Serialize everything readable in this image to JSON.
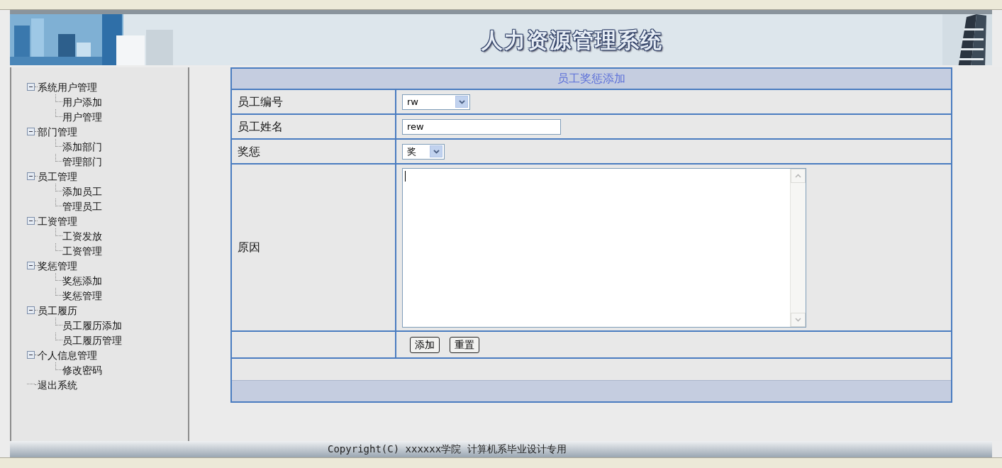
{
  "banner": {
    "title": "人力资源管理系统"
  },
  "sidebar": {
    "tree": [
      {
        "label": "系统用户管理",
        "expanded": true,
        "children": [
          {
            "label": "用户添加"
          },
          {
            "label": "用户管理"
          }
        ]
      },
      {
        "label": "部门管理",
        "expanded": true,
        "children": [
          {
            "label": "添加部门"
          },
          {
            "label": "管理部门"
          }
        ]
      },
      {
        "label": "员工管理",
        "expanded": true,
        "children": [
          {
            "label": "添加员工"
          },
          {
            "label": "管理员工"
          }
        ]
      },
      {
        "label": "工资管理",
        "expanded": true,
        "children": [
          {
            "label": "工资发放"
          },
          {
            "label": "工资管理"
          }
        ]
      },
      {
        "label": "奖惩管理",
        "expanded": true,
        "children": [
          {
            "label": "奖惩添加"
          },
          {
            "label": "奖惩管理"
          }
        ]
      },
      {
        "label": "员工履历",
        "expanded": true,
        "children": [
          {
            "label": "员工履历添加"
          },
          {
            "label": "员工履历管理"
          }
        ]
      },
      {
        "label": "个人信息管理",
        "expanded": true,
        "children": [
          {
            "label": "修改密码"
          }
        ]
      },
      {
        "label": "退出系统"
      }
    ]
  },
  "form": {
    "title": "员工奖惩添加",
    "fields": [
      {
        "kind": "select",
        "label": "员工编号",
        "value": "rw"
      },
      {
        "kind": "text",
        "label": "员工姓名",
        "value": "rew"
      },
      {
        "kind": "select",
        "label": "奖惩",
        "value": "奖"
      },
      {
        "kind": "textarea",
        "label": "原因"
      }
    ],
    "buttons": [
      "添加",
      "重置"
    ]
  },
  "footer": {
    "copyright": "Copyright(C) xxxxxx学院 计算机系毕业设计专用"
  }
}
